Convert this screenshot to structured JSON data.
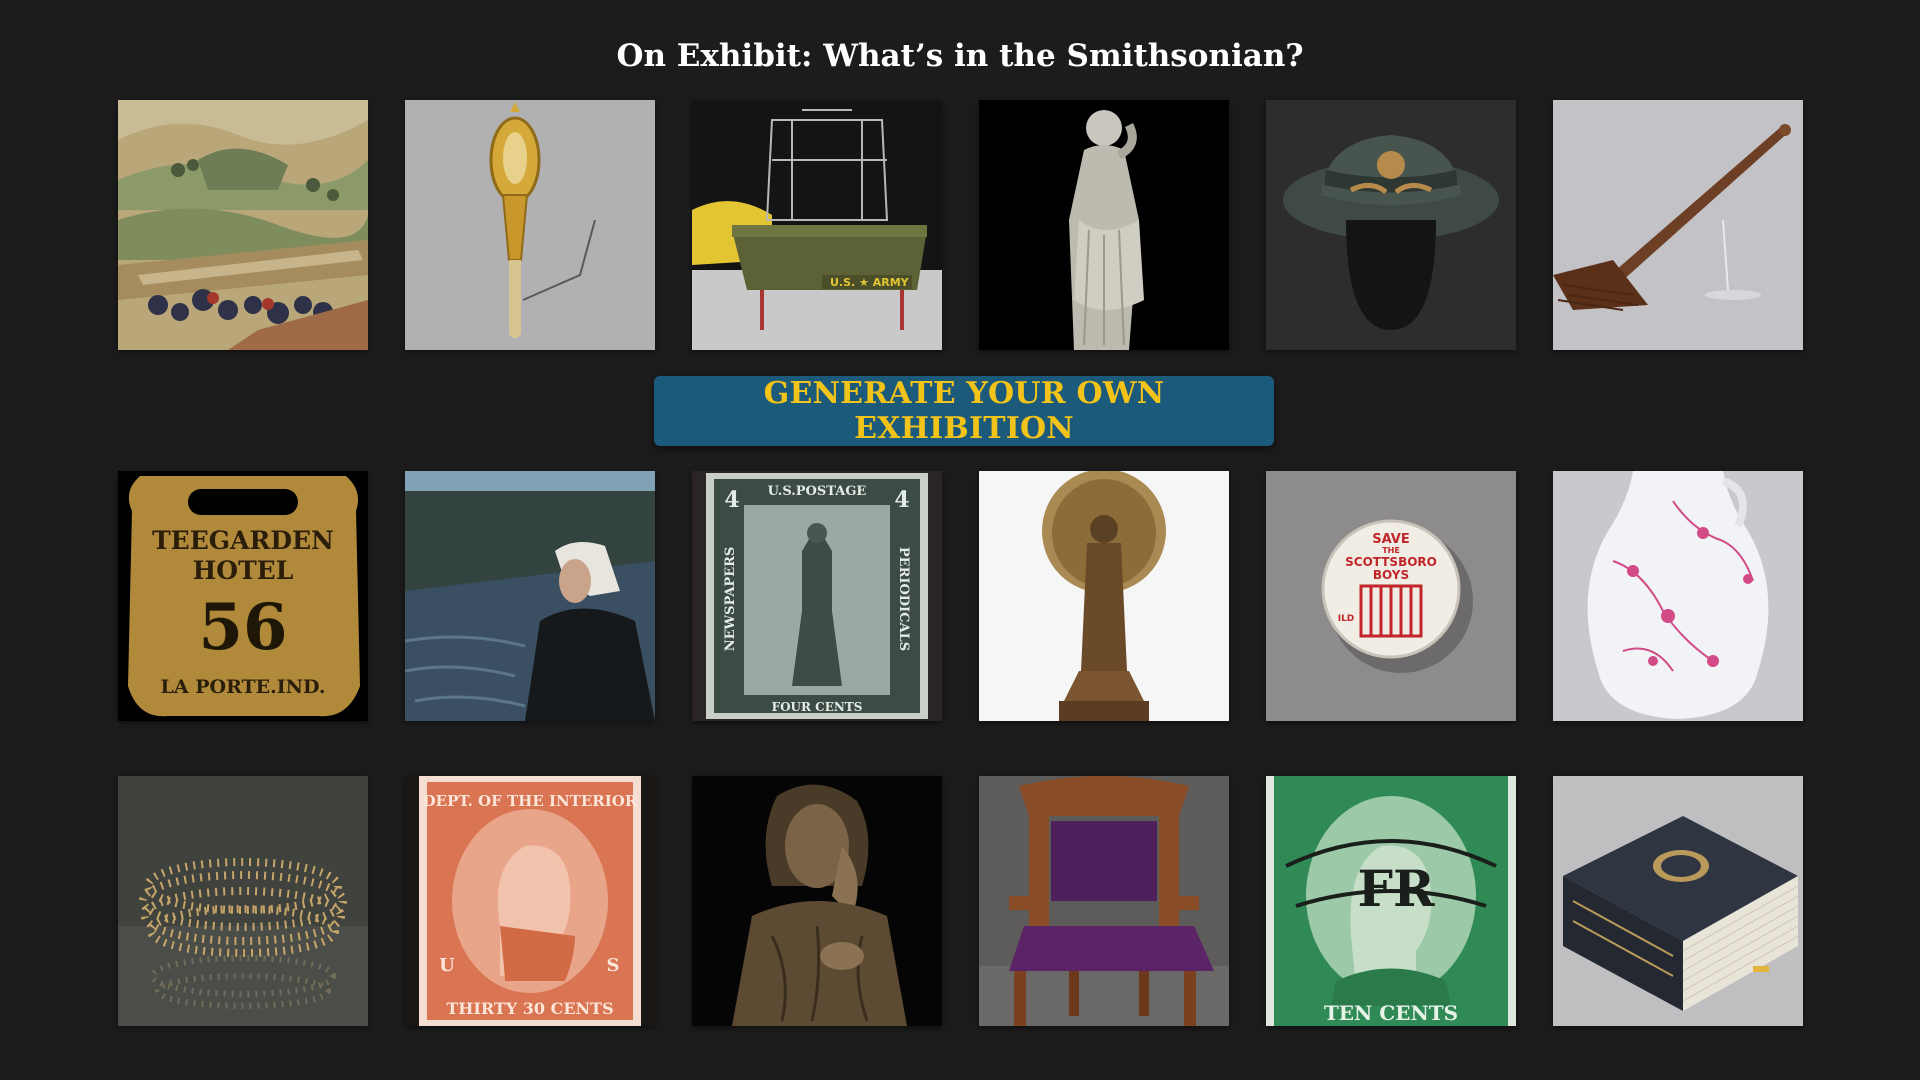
{
  "header": {
    "title": "On Exhibit: What’s in the Smithsonian?"
  },
  "actions": {
    "generate_label": "GENERATE YOUR OWN EXHIBITION"
  },
  "theme": {
    "background": "#1c1c1c",
    "button_bg": "#1b5a7a",
    "button_text": "#f2c318",
    "title_color": "#ffffff"
  },
  "artifacts": {
    "hotel_tag": {
      "line1": "TEEGARDEN",
      "line2": "HOTEL",
      "number": "56",
      "line3": "LA PORTE.IND."
    },
    "newspaper_stamp": {
      "top": "U.S.POSTAGE",
      "left": "NEWSPAPERS",
      "right": "PERIODICALS",
      "bottom": "FOUR CENTS",
      "corner": "4"
    },
    "scottsboro_button": {
      "line1": "SAVE",
      "line2": "THE",
      "line3": "SCOTTSBORO",
      "line4": "BOYS",
      "side": "ILD"
    },
    "interior_stamp": {
      "top": "DEPT. OF THE INTERIOR",
      "left": "U",
      "right": "S",
      "bottom": "THIRTY 30 CENTS"
    },
    "ten_cent_stamp": {
      "bottom": "TEN CENTS",
      "cancel": "FR"
    },
    "helicopter": {
      "marking": "U.S. ★ ARMY"
    }
  }
}
